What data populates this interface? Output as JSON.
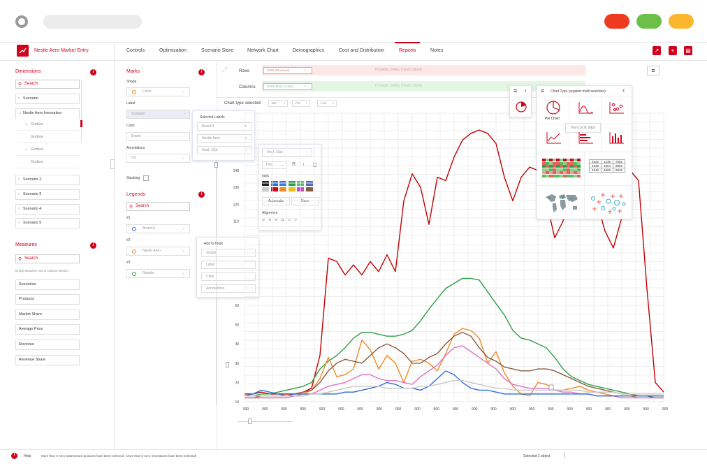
{
  "nav": {
    "brand": "Nestle Aero Market Entry",
    "items": [
      "Controls",
      "Optimization",
      "Scenario Store",
      "Network Chart",
      "Demographics",
      "Cost and Distribution",
      "Reports",
      "Notes"
    ],
    "active": "Reports"
  },
  "dimensions": {
    "title": "Dimensions",
    "search_placeholder": "Search",
    "items": [
      "Scenario",
      "Nestle Aero Innovation",
      "Godiva",
      "Godiva",
      "Godiva",
      "Godiva",
      "Scenario 2",
      "Scenario 3",
      "Scenario 4",
      "Scenario 5"
    ]
  },
  "measures": {
    "title": "Measures",
    "search_placeholder": "Search",
    "hint": "Drag/measures row or column section",
    "items": [
      "Scenarios",
      "Products",
      "Market Share",
      "Average Price",
      "Revenue",
      "Revenue Share"
    ]
  },
  "marks": {
    "title": "Marks",
    "shape_label": "Shape",
    "shape_value": "Circle",
    "label_label": "Label",
    "label_value": "Scenario",
    "color_label": "Color",
    "color_value": "Brand",
    "annotations_label": "Annotations",
    "annotations_value": "On",
    "stacking_label": "Stacking"
  },
  "legends": {
    "title": "Legends",
    "search_placeholder": "Search",
    "groups": [
      {
        "num": "#1",
        "value": "Brand A",
        "color": "#2f6fd6"
      },
      {
        "num": "#2",
        "value": "Nestle Aero",
        "color": "#f08a24"
      },
      {
        "num": "#3",
        "value": "Retailer",
        "color": "#2ea043"
      }
    ]
  },
  "selected_labels": {
    "title": "Selected Labels",
    "items": [
      "Brand A",
      "Nestle Aero",
      "Arial, 12pt"
    ]
  },
  "font_popup": {
    "font": "Arial, 10pt",
    "size": "10pt",
    "bold": "B",
    "italic": "I",
    "underline": "U",
    "color_title": "Italic",
    "automatic": "Automatic",
    "none": "None",
    "alignment_title": "Alignment",
    "swatches": [
      "#222222",
      "#2f6fd6",
      "#3a7bd5",
      "#2ea043",
      "#55b67a",
      "#4c6fb3",
      "#cccccc",
      "#d0021b",
      "#f08a24",
      "#e8c21c",
      "#c050c0",
      "#8a5a44"
    ]
  },
  "add_to_mark": {
    "title": "Add to Mark",
    "items": [
      "Shape",
      "Label",
      "Color",
      "Annotations"
    ]
  },
  "shelf": {
    "rows_label": "Rows",
    "rows_pill": "SUM (Revenue)",
    "columns_label": "Columns",
    "columns_pill": "SUM (Gain / Loss)",
    "drop_text": "PLEASE DRAG ITEMS HERE",
    "chart_type_label": "Chart type selected:",
    "chart_types": [
      "Bar",
      "Pie",
      "Line"
    ]
  },
  "chart_type_panel": {
    "title": "Chart Type (support multi selection)",
    "pie_label": "Pie Chart",
    "tooltip": "Non cyclic data",
    "table": [
      [
        "2532",
        "1235",
        "7802"
      ],
      [
        "4648",
        "2364",
        "9866"
      ],
      [
        "4646",
        "4669",
        "6626"
      ]
    ]
  },
  "status": {
    "help": "Help",
    "message": "More than 5 Aero Mainstream products have been selected ; More than 5 Aero Innovations have been selected!",
    "selection": "Selected 1 object"
  },
  "chart_data": {
    "type": "line",
    "y_ticks": [
      10,
      20,
      30,
      40,
      50,
      60,
      110,
      120,
      130,
      140
    ],
    "x_tick_label": "900",
    "x": [
      0,
      1,
      2,
      3,
      4,
      5,
      6,
      7,
      8,
      9,
      10,
      11,
      12,
      13,
      14,
      15,
      16,
      17,
      18,
      19,
      20,
      21,
      22,
      23,
      24,
      25,
      26,
      27,
      28,
      29,
      30,
      31,
      32,
      33,
      34,
      35,
      36,
      37,
      38,
      39,
      40,
      41,
      42,
      43,
      44,
      45,
      46,
      47,
      48,
      49,
      50
    ],
    "series": [
      {
        "color": "#c00000",
        "values": [
          14,
          14,
          15,
          14,
          14,
          14,
          14,
          15,
          17,
          34,
          88,
          86,
          78,
          84,
          78,
          86,
          80,
          90,
          80,
          122,
          138,
          130,
          108,
          136,
          134,
          148,
          158,
          162,
          164,
          162,
          156,
          136,
          122,
          136,
          142,
          140,
          122,
          100,
          110,
          128,
          142,
          146,
          122,
          104,
          94,
          112,
          140,
          134,
          70,
          20,
          15
        ]
      },
      {
        "color": "#2ea043",
        "values": [
          13,
          13,
          14,
          14,
          15,
          16,
          17,
          18,
          20,
          27,
          31,
          34,
          38,
          43,
          46,
          46,
          45,
          44,
          44,
          45,
          47,
          52,
          58,
          64,
          70,
          73,
          76,
          76,
          75,
          68,
          61,
          55,
          47,
          43,
          42,
          40,
          38,
          33,
          27,
          23,
          21,
          19,
          18,
          17,
          16,
          15,
          14,
          13,
          13,
          13,
          13
        ]
      },
      {
        "color": "#f08a24",
        "values": [
          12,
          12,
          12,
          12,
          12,
          12,
          13,
          14,
          16,
          22,
          33,
          23,
          24,
          27,
          42,
          37,
          27,
          34,
          30,
          20,
          31,
          32,
          30,
          26,
          35,
          45,
          48,
          47,
          43,
          30,
          36,
          25,
          18,
          14,
          13,
          20,
          19,
          16,
          16,
          17,
          18,
          16,
          15,
          14,
          13,
          13,
          13,
          12,
          12,
          12,
          12
        ]
      },
      {
        "color": "#8a5a44",
        "values": [
          12,
          12,
          13,
          13,
          13,
          13,
          14,
          15,
          16,
          20,
          26,
          30,
          32,
          31,
          30,
          34,
          38,
          40,
          38,
          35,
          30,
          30,
          33,
          35,
          40,
          44,
          46,
          44,
          38,
          33,
          31,
          28,
          27,
          26,
          26,
          27,
          27,
          26,
          24,
          22,
          20,
          18,
          17,
          16,
          15,
          14,
          14,
          13,
          13,
          12,
          12
        ]
      },
      {
        "color": "#e070c8",
        "values": [
          12,
          12,
          12,
          12,
          12,
          12,
          13,
          13,
          14,
          16,
          18,
          19,
          20,
          22,
          24,
          24,
          22,
          21,
          21,
          20,
          19,
          23,
          26,
          29,
          34,
          38,
          39,
          36,
          33,
          30,
          27,
          22,
          19,
          18,
          17,
          17,
          17,
          16,
          15,
          15,
          14,
          14,
          13,
          13,
          13,
          12,
          12,
          12,
          12,
          12,
          12
        ]
      },
      {
        "color": "#2f6fd6",
        "values": [
          13,
          14,
          16,
          15,
          14,
          13,
          14,
          14,
          14,
          14,
          14,
          14,
          15,
          15,
          16,
          17,
          18,
          20,
          19,
          17,
          17,
          16,
          18,
          22,
          26,
          24,
          20,
          17,
          16,
          16,
          15,
          14,
          14,
          14,
          14,
          14,
          14,
          14,
          14,
          14,
          14,
          14,
          13,
          13,
          13,
          13,
          13,
          13,
          13,
          13,
          13
        ]
      },
      {
        "color": "#c8c8c8",
        "values": [
          13,
          13,
          13,
          13,
          13,
          13,
          13,
          13,
          14,
          14,
          15,
          16,
          17,
          18,
          18,
          18,
          18,
          17,
          17,
          17,
          17,
          18,
          18,
          19,
          20,
          21,
          21,
          20,
          19,
          18,
          17,
          17,
          16,
          16,
          16,
          16,
          16,
          16,
          16,
          16,
          16,
          15,
          15,
          15,
          15,
          14,
          14,
          14,
          14,
          14,
          14
        ]
      }
    ]
  }
}
